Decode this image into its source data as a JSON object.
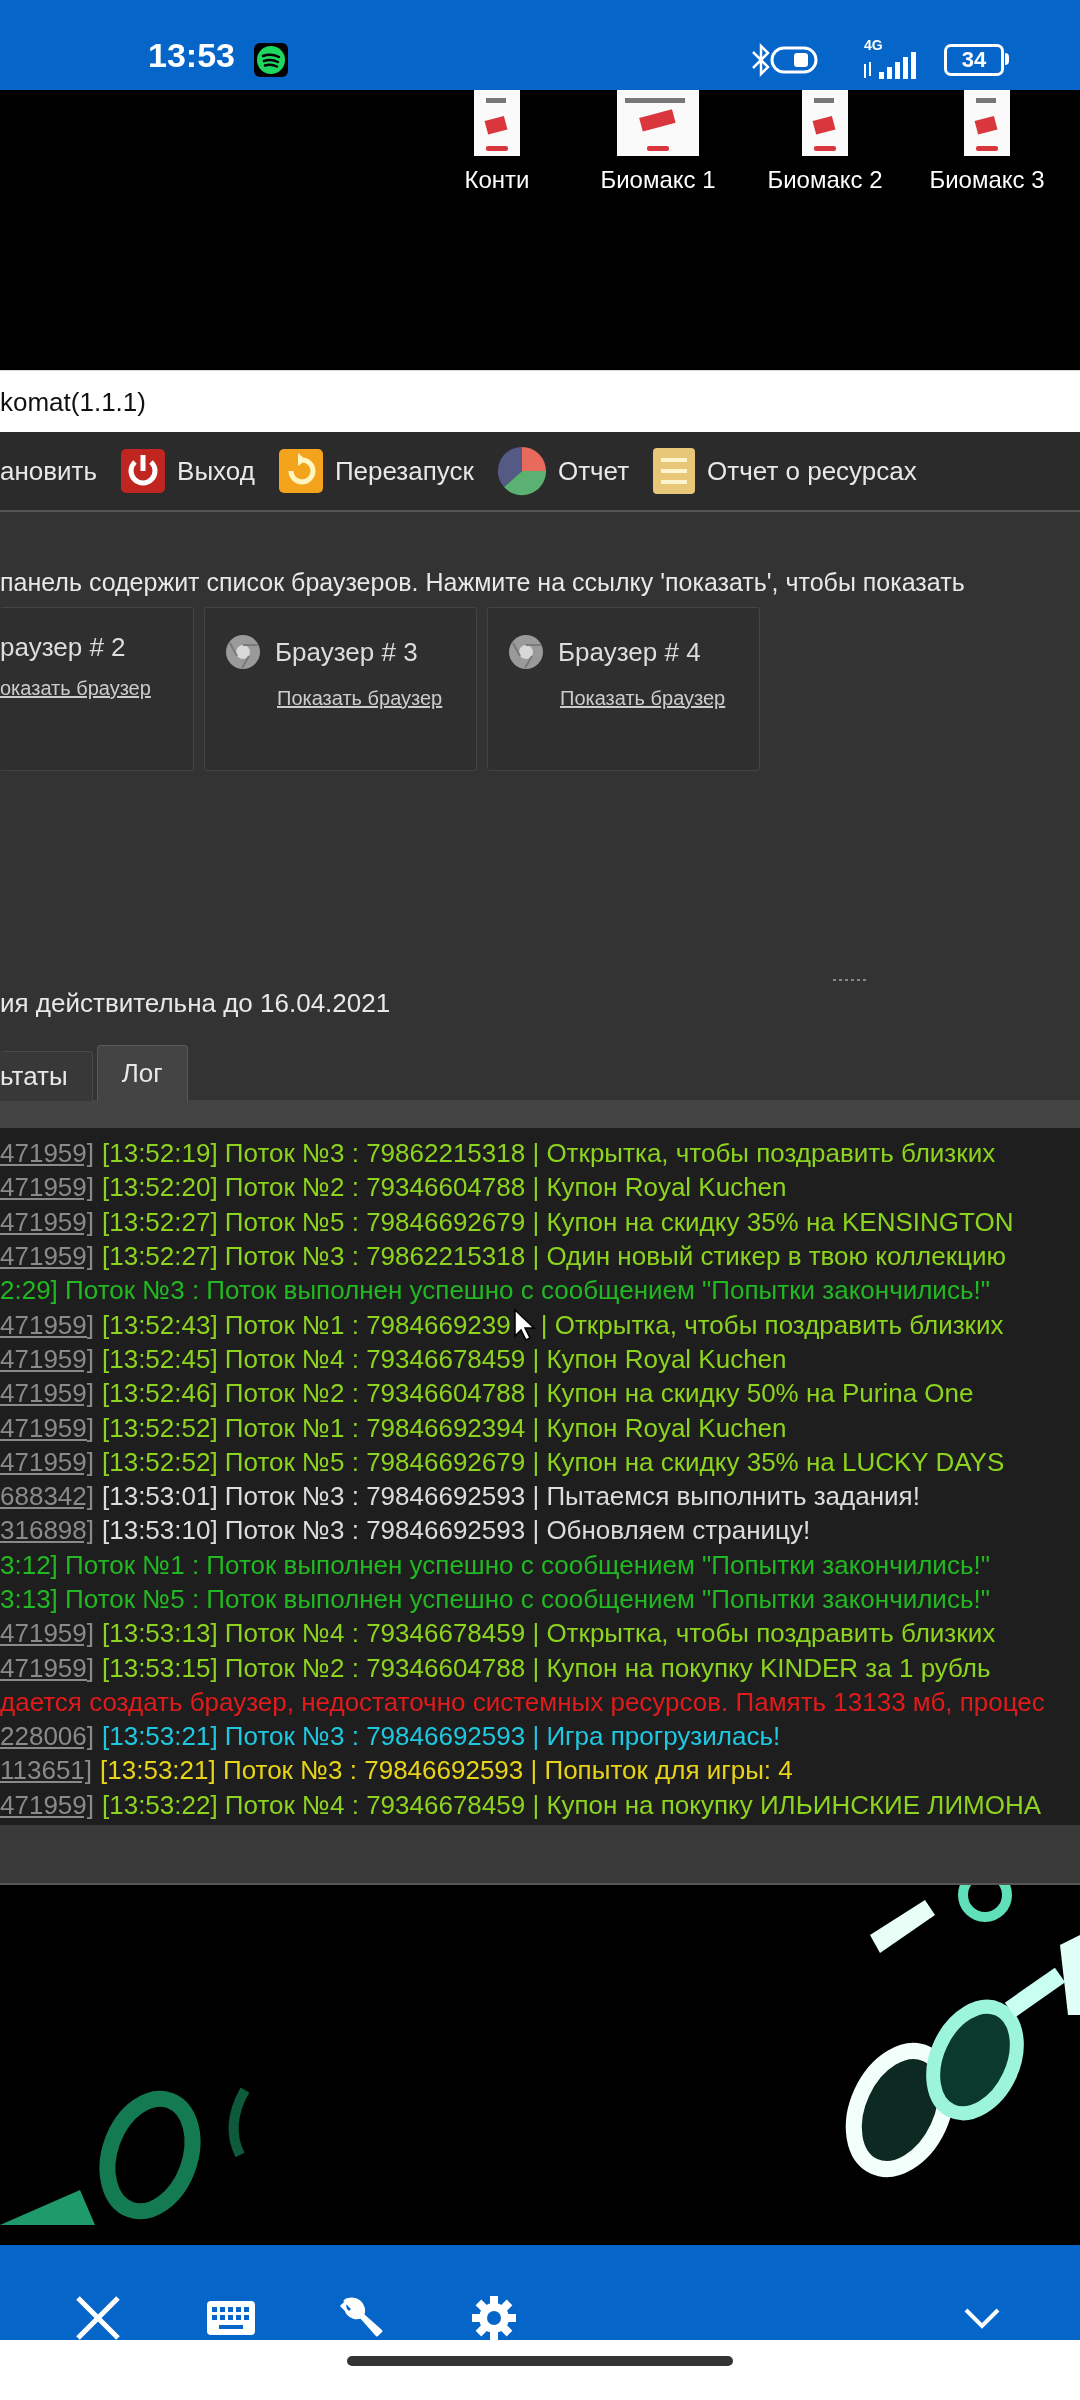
{
  "status_bar": {
    "time": "13:53",
    "network": "4G",
    "battery": "34"
  },
  "desktop_icons": [
    {
      "label": "Конти"
    },
    {
      "label": "Биомакс 1"
    },
    {
      "label": "Биомакс 2"
    },
    {
      "label": "Биомакс 3"
    }
  ],
  "window": {
    "title": "komat(1.1.1)"
  },
  "toolbar": [
    {
      "label": "ановить",
      "kind": "text"
    },
    {
      "label": "Выход",
      "kind": "power"
    },
    {
      "label": "Перезапуск",
      "kind": "restart"
    },
    {
      "label": "Отчет",
      "kind": "pie"
    },
    {
      "label": "Отчет о ресурсах",
      "kind": "document"
    }
  ],
  "description": "панель содержит список браузеров. Нажмите на ссылку 'показать', чтобы показать",
  "browsers": [
    {
      "title": "раузер # 2",
      "link": "оказать браузер"
    },
    {
      "title": "Браузер # 3",
      "link": "Показать браузер"
    },
    {
      "title": "Браузер # 4",
      "link": "Показать браузер"
    }
  ],
  "license_text": "ия действительна до 16.04.2021",
  "tabs": [
    {
      "label": "ьтаты",
      "selected": false
    },
    {
      "label": "Лог",
      "selected": true
    }
  ],
  "log": [
    {
      "prefix": "471959]",
      "text": "[13:52:19] Поток №3 : 79862215318 | Открытка, чтобы поздравить близких",
      "color": "#8cd41e"
    },
    {
      "prefix": "471959]",
      "text": "[13:52:20] Поток №2 : 79346604788 | Купон Royal Kuchen",
      "color": "#8cd41e"
    },
    {
      "prefix": "471959]",
      "text": "[13:52:27] Поток №5 : 79846692679 | Купон на скидку 35% на KENSINGTON",
      "color": "#8cd41e"
    },
    {
      "prefix": "471959]",
      "text": "[13:52:27] Поток №3 : 79862215318 | Один новый стикер в твою коллекцию",
      "color": "#8cd41e"
    },
    {
      "text": "2:29] Поток №3 : Поток выполнен успешно с сообщением \"Попытки закончились!\"",
      "color": "#22b822"
    },
    {
      "prefix": "471959]",
      "text": "[13:52:43] Поток №1 : 7984669239",
      "text_after_cursor": "| Открытка, чтобы поздравить близких",
      "color": "#8cd41e"
    },
    {
      "prefix": "471959]",
      "text": "[13:52:45] Поток №4 : 79346678459 | Купон Royal Kuchen",
      "color": "#8cd41e"
    },
    {
      "prefix": "471959]",
      "text": "[13:52:46] Поток №2 : 79346604788 | Купон на скидку 50% на Purina One",
      "color": "#8cd41e"
    },
    {
      "prefix": "471959]",
      "text": "[13:52:52] Поток №1 : 79846692394 | Купон Royal Kuchen",
      "color": "#8cd41e"
    },
    {
      "prefix": "471959]",
      "text": "[13:52:52] Поток №5 : 79846692679 | Купон на скидку 35% на LUCKY DAYS",
      "color": "#8cd41e"
    },
    {
      "prefix": "688342]",
      "text": "[13:53:01] Поток №3 : 79846692593 | Пытаемся выполнить задания!",
      "color": "#dcdcdc"
    },
    {
      "prefix": "316898]",
      "text": "[13:53:10] Поток №3 : 79846692593 | Обновляем страницу!",
      "color": "#dcdcdc"
    },
    {
      "text": "3:12] Поток №1 : Поток выполнен успешно с сообщением \"Попытки закончились!\"",
      "color": "#22b822"
    },
    {
      "text": "3:13] Поток №5 : Поток выполнен успешно с сообщением \"Попытки закончились!\"",
      "color": "#22b822"
    },
    {
      "prefix": "471959]",
      "text": "[13:53:13] Поток №4 : 79346678459 | Открытка, чтобы поздравить близких",
      "color": "#8cd41e"
    },
    {
      "prefix": "471959]",
      "text": "[13:53:15] Поток №2 : 79346604788 | Купон на покупку KINDER за 1 рубль",
      "color": "#8cd41e"
    },
    {
      "text": "дается создать браузер, недостаточно системных ресурсов. Память 13133 мб, процес",
      "color": "#e01b1b"
    },
    {
      "prefix": "228006]",
      "text": "[13:53:21] Поток №3 : 79846692593 | Игра прогрузилась!",
      "color": "#1ec8e0"
    },
    {
      "prefix": "113651]",
      "text": "[13:53:21] Поток №3 : 79846692593 | Попыток для игры: 4",
      "color": "#e6d31a"
    },
    {
      "prefix": "471959]",
      "text": "[13:53:22] Поток №4 : 79346678459 | Купон на покупку ИЛЬИНСКИЕ ЛИМОНА",
      "color": "#8cd41e"
    }
  ]
}
